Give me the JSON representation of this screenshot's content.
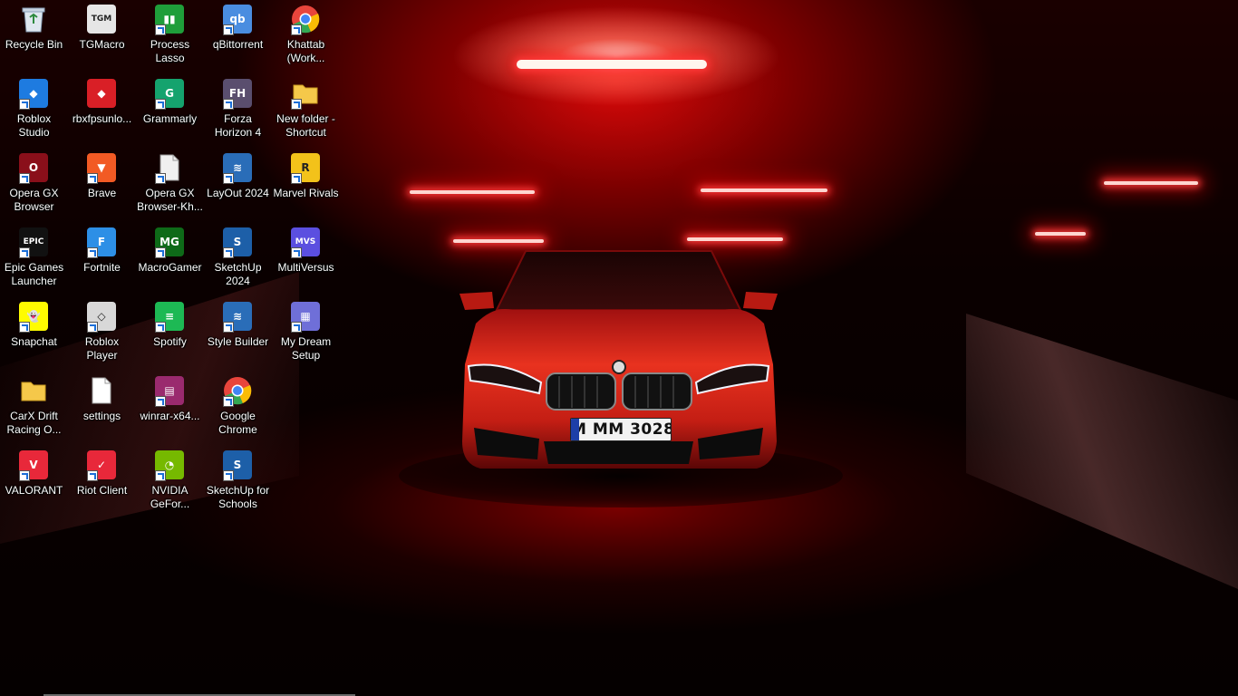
{
  "desktop": {
    "icons": [
      {
        "label": "Recycle Bin",
        "icon": "recycle-bin-icon",
        "color": "#dfe7ef",
        "glyph": "♻",
        "shortcut": false
      },
      {
        "label": "TGMacro",
        "icon": "tgmacro-icon",
        "color": "#e6e6e6",
        "glyph": "TGM",
        "shortcut": false
      },
      {
        "label": "Process\nLasso",
        "icon": "process-lasso-icon",
        "color": "#1f9e3a",
        "glyph": "▮▮",
        "shortcut": true
      },
      {
        "label": "qBittorrent",
        "icon": "qbittorrent-icon",
        "color": "#4a8de0",
        "glyph": "qb",
        "shortcut": true
      },
      {
        "label": "Khattab\n(Work...",
        "icon": "chrome-profile-icon",
        "color": "#e8453c",
        "glyph": "◉",
        "shortcut": true
      },
      {
        "label": "Roblox\nStudio",
        "icon": "roblox-studio-icon",
        "color": "#1e7be0",
        "glyph": "◆",
        "shortcut": true
      },
      {
        "label": "rbxfpsunlo...",
        "icon": "rbxfpsunlocker-icon",
        "color": "#d91f26",
        "glyph": "◆",
        "shortcut": false
      },
      {
        "label": "Grammarly",
        "icon": "grammarly-icon",
        "color": "#15a36e",
        "glyph": "G",
        "shortcut": true
      },
      {
        "label": "Forza\nHorizon 4",
        "icon": "forza-horizon-icon",
        "color": "#5a4e6e",
        "glyph": "FH",
        "shortcut": true
      },
      {
        "label": "New folder -\nShortcut",
        "icon": "folder-icon",
        "color": "#f5c84a",
        "glyph": "",
        "shortcut": true
      },
      {
        "label": "Opera GX\nBrowser",
        "icon": "opera-gx-icon",
        "color": "#8a0f1a",
        "glyph": "O",
        "shortcut": true
      },
      {
        "label": "Brave",
        "icon": "brave-icon",
        "color": "#f25a24",
        "glyph": "▼",
        "shortcut": true
      },
      {
        "label": "Opera GX\nBrowser-Kh...",
        "icon": "file-icon",
        "color": "#f0f0f0",
        "glyph": "",
        "shortcut": true
      },
      {
        "label": "LayOut 2024",
        "icon": "layout-icon",
        "color": "#2a6db8",
        "glyph": "≋",
        "shortcut": true
      },
      {
        "label": "Marvel Rivals",
        "icon": "marvel-rivals-icon",
        "color": "#f3c21a",
        "glyph": "R",
        "shortcut": true
      },
      {
        "label": "Epic Games\nLauncher",
        "icon": "epic-games-icon",
        "color": "#111111",
        "glyph": "EPIC",
        "shortcut": true
      },
      {
        "label": "Fortnite",
        "icon": "fortnite-icon",
        "color": "#2d8fe6",
        "glyph": "F",
        "shortcut": true
      },
      {
        "label": "MacroGamer",
        "icon": "macrogamer-icon",
        "color": "#0e6a18",
        "glyph": "MG",
        "shortcut": true
      },
      {
        "label": "SketchUp\n2024",
        "icon": "sketchup-icon",
        "color": "#1d5fa8",
        "glyph": "S",
        "shortcut": true
      },
      {
        "label": "MultiVersus",
        "icon": "multiversus-icon",
        "color": "#5b4fe0",
        "glyph": "MVS",
        "shortcut": true
      },
      {
        "label": "Snapchat",
        "icon": "snapchat-icon",
        "color": "#fffc00",
        "glyph": "👻",
        "shortcut": true
      },
      {
        "label": "Roblox\nPlayer",
        "icon": "roblox-player-icon",
        "color": "#d8d8d8",
        "glyph": "◇",
        "shortcut": true
      },
      {
        "label": "Spotify",
        "icon": "spotify-icon",
        "color": "#1db954",
        "glyph": "≡",
        "shortcut": true
      },
      {
        "label": "Style Builder",
        "icon": "style-builder-icon",
        "color": "#2a6db8",
        "glyph": "≋",
        "shortcut": true
      },
      {
        "label": "My Dream\nSetup",
        "icon": "my-dream-setup-icon",
        "color": "#6f6fd8",
        "glyph": "▦",
        "shortcut": true
      },
      {
        "label": "CarX Drift\nRacing O...",
        "icon": "folder-icon",
        "color": "#f5c84a",
        "glyph": "",
        "shortcut": false
      },
      {
        "label": "settings",
        "icon": "file-icon",
        "color": "#ffffff",
        "glyph": "",
        "shortcut": false
      },
      {
        "label": "winrar-x64...",
        "icon": "winrar-icon",
        "color": "#9a2a6e",
        "glyph": "▤",
        "shortcut": true
      },
      {
        "label": "Google\nChrome",
        "icon": "chrome-icon",
        "color": "#e8453c",
        "glyph": "◉",
        "shortcut": true
      },
      {
        "label": "",
        "icon": "",
        "color": "",
        "glyph": "",
        "shortcut": false
      },
      {
        "label": "VALORANT",
        "icon": "valorant-icon",
        "color": "#e8283a",
        "glyph": "V",
        "shortcut": true
      },
      {
        "label": "Riot Client",
        "icon": "riot-client-icon",
        "color": "#e8283a",
        "glyph": "✓",
        "shortcut": true
      },
      {
        "label": "NVIDIA\nGeFor...",
        "icon": "nvidia-icon",
        "color": "#76b900",
        "glyph": "◔",
        "shortcut": true
      },
      {
        "label": "SketchUp for\nSchools",
        "icon": "sketchup-icon",
        "color": "#1d5fa8",
        "glyph": "S",
        "shortcut": true
      }
    ]
  },
  "wallpaper": {
    "plate_text": "M MM 3028",
    "accent": "#d40000"
  }
}
